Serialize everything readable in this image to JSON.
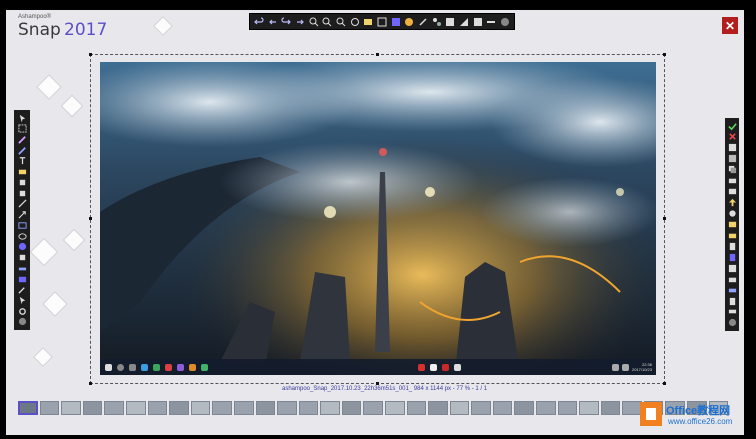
{
  "app": {
    "brand": "Ashampoo®",
    "name": "Snap",
    "version": "2017"
  },
  "top_toolbar": {
    "icons": [
      "undo-icon",
      "undo-all-icon",
      "redo-icon",
      "redo-all-icon",
      "zoom-in-icon",
      "zoom-out-icon",
      "zoom-fit-icon",
      "zoom-100-icon",
      "rotate-icon",
      "crop-icon",
      "resize-canvas-icon",
      "select-icon",
      "color-picker-icon",
      "effects-icon",
      "brightness-icon",
      "sharpen-icon",
      "blur-icon",
      "frame-icon",
      "options-icon",
      "help-icon"
    ]
  },
  "left_toolbar": {
    "icons": [
      "move-icon",
      "select-area-icon",
      "draw-icon",
      "marker-icon",
      "text-icon",
      "color-fill-icon",
      "eraser-icon",
      "brush-icon",
      "line-icon",
      "arrow-icon",
      "rectangle-icon",
      "ellipse-icon",
      "numbering-icon",
      "stamp-icon",
      "highlight-icon",
      "blur-tool-icon",
      "pipette-icon",
      "cursor-icon",
      "settings-icon",
      "help-icon"
    ]
  },
  "right_toolbar": {
    "icons": [
      "confirm-icon",
      "discard-icon",
      "save-icon",
      "save-as-icon",
      "copy-icon",
      "print-icon",
      "email-icon",
      "upload-icon",
      "share-icon",
      "export-icon",
      "open-folder-icon",
      "paste-icon",
      "new-icon",
      "template-icon",
      "folder-icon",
      "drive-icon",
      "clipboard-icon",
      "more-icon",
      "help-icon"
    ]
  },
  "status": {
    "text": "ashampoo_Snap_2017.10.23_22h36m51s_001_ 984 x 1144 px - 77 % - 1 / 1"
  },
  "taskbar": {
    "time": "22:36",
    "date": "2017/10/23"
  },
  "thumbnails": {
    "count": 33,
    "active_index": 0
  },
  "watermark": {
    "title": "Office教程网",
    "url": "www.office26.com"
  },
  "colors": {
    "accent": "#5a4fc9",
    "close": "#b21e1e",
    "toolbar": "#1d1d1d",
    "canvas_bg": "#e8e8ec"
  }
}
